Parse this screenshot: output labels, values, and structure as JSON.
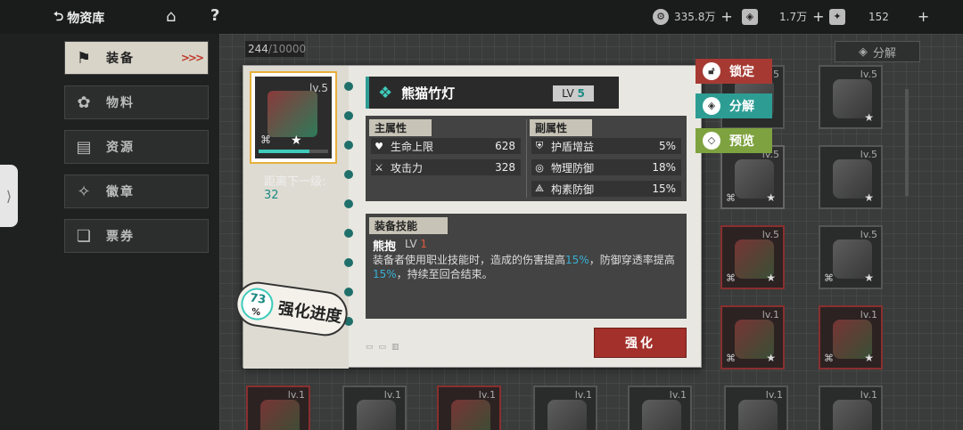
{
  "topbar": {
    "back_label": "物资库",
    "resources": [
      {
        "icon": "gear-coin-icon",
        "value": "335.8万"
      },
      {
        "icon": "crystal-icon",
        "value": "1.7万"
      },
      {
        "icon": "ticket-icon",
        "value": "152"
      }
    ]
  },
  "sidebar": {
    "items": [
      {
        "label": "装备",
        "icon": "equipment-icon",
        "active": true
      },
      {
        "label": "物料",
        "icon": "material-icon",
        "active": false
      },
      {
        "label": "资源",
        "icon": "resource-icon",
        "active": false
      },
      {
        "label": "徽章",
        "icon": "badge-icon",
        "active": false
      },
      {
        "label": "票券",
        "icon": "ticket-icon",
        "active": false
      }
    ]
  },
  "inventory": {
    "count": "244",
    "capacity": "/10000",
    "decompose_label": "分解",
    "tiles": [
      {
        "lv": "lv.5"
      },
      {
        "lv": "lv.5"
      },
      {
        "lv": "lv.5"
      },
      {
        "lv": "lv.5"
      },
      {
        "lv": "lv.5"
      },
      {
        "lv": "lv.1"
      },
      {
        "lv": "lv.1"
      },
      {
        "lv": "lv.1"
      },
      {
        "lv": "lv.1"
      },
      {
        "lv": "lv.1"
      },
      {
        "lv": "lv.1"
      },
      {
        "lv": "lv.1"
      },
      {
        "lv": "lv.1"
      }
    ]
  },
  "detail": {
    "item_lv": "lv.5",
    "name": "熊猫竹灯",
    "lv_prefix": "LV",
    "lv_value": "5",
    "next_level_label": "距离下一级:",
    "next_level_value": "32",
    "enhance_percent": "73",
    "enhance_percent_sign": "%",
    "enhance_label": "强化进度",
    "exp_progress": 0.73,
    "main_stats_header": "主属性",
    "sub_stats_header": "副属性",
    "main_stats": [
      {
        "icon": "heart-icon",
        "name": "生命上限",
        "value": "628"
      },
      {
        "icon": "swords-icon",
        "name": "攻击力",
        "value": "328"
      }
    ],
    "sub_stats": [
      {
        "icon": "shield-boost-icon",
        "name": "护盾增益",
        "value": "5%"
      },
      {
        "icon": "shield-icon",
        "name": "物理防御",
        "value": "18%"
      },
      {
        "icon": "element-icon",
        "name": "构素防御",
        "value": "15%"
      }
    ],
    "skill_header": "装备技能",
    "skill_name": "熊抱",
    "skill_lv_prefix": "LV",
    "skill_lv_value": "1",
    "skill_desc_1": "装备者使用职业技能时，造成的伤害提高",
    "skill_hl_1": "15%",
    "skill_desc_2": "，防御穿透率提高",
    "skill_hl_2": "15%",
    "skill_desc_3": "，持续至回合结束。",
    "strengthen_label": "强化"
  },
  "actions": {
    "lock_label": "锁定",
    "decompose_label": "分解",
    "preview_label": "预览"
  },
  "colors": {
    "accent_teal": "#2d9d94",
    "lock_red": "#a63a33",
    "preview_green": "#7ea23f",
    "strengthen_red": "#a3302a",
    "highlight_blue": "#3ab0d8"
  }
}
